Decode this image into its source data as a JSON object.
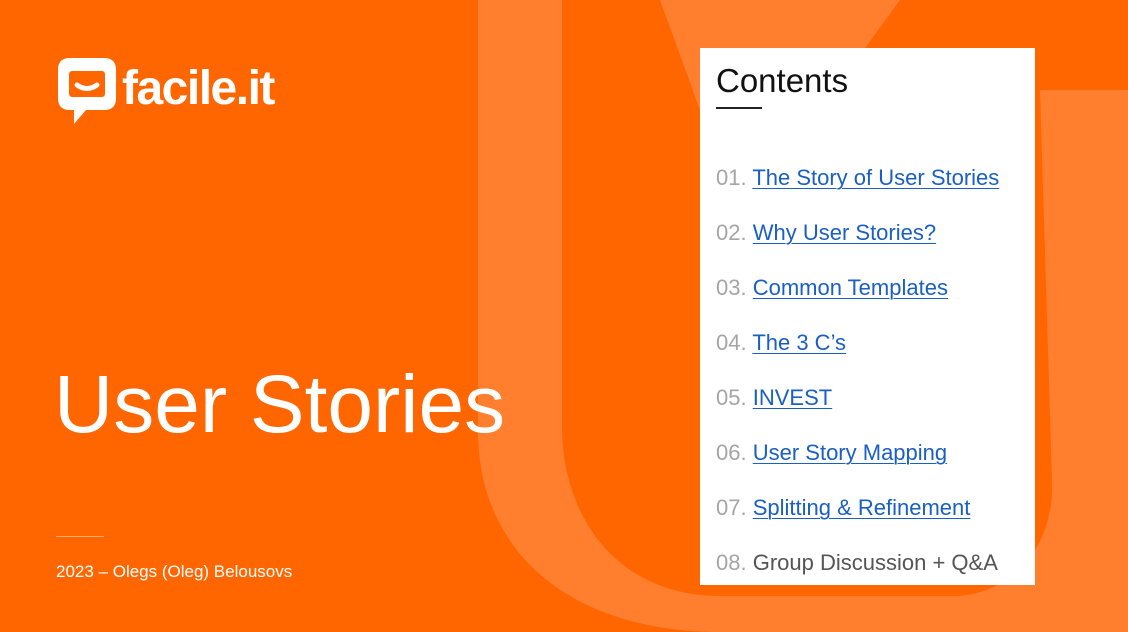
{
  "slide": {
    "background_color": "#ff6600",
    "watermark_color": "#ff7f2e"
  },
  "logo": {
    "text": "facile.it",
    "icon": "speech-bubble-smile-icon"
  },
  "title": "User Stories",
  "subtitle": "2023 – Olegs (Oleg) Belousovs",
  "contents": {
    "heading": "Contents",
    "link_color": "#1a5fc4",
    "items": [
      {
        "number": "01.",
        "label": "The Story of User Stories",
        "is_link": true
      },
      {
        "number": "02.",
        "label": "Why User Stories?",
        "is_link": true
      },
      {
        "number": "03.",
        "label": "Common Templates",
        "is_link": true
      },
      {
        "number": "04.",
        "label": "The 3 C’s",
        "is_link": true
      },
      {
        "number": "05.",
        "label": "INVEST",
        "is_link": true
      },
      {
        "number": "06.",
        "label": "User Story Mapping",
        "is_link": true
      },
      {
        "number": "07.",
        "label": "Splitting & Refinement",
        "is_link": true
      },
      {
        "number": "08.",
        "label": "Group Discussion + Q&A",
        "is_link": false
      }
    ]
  }
}
